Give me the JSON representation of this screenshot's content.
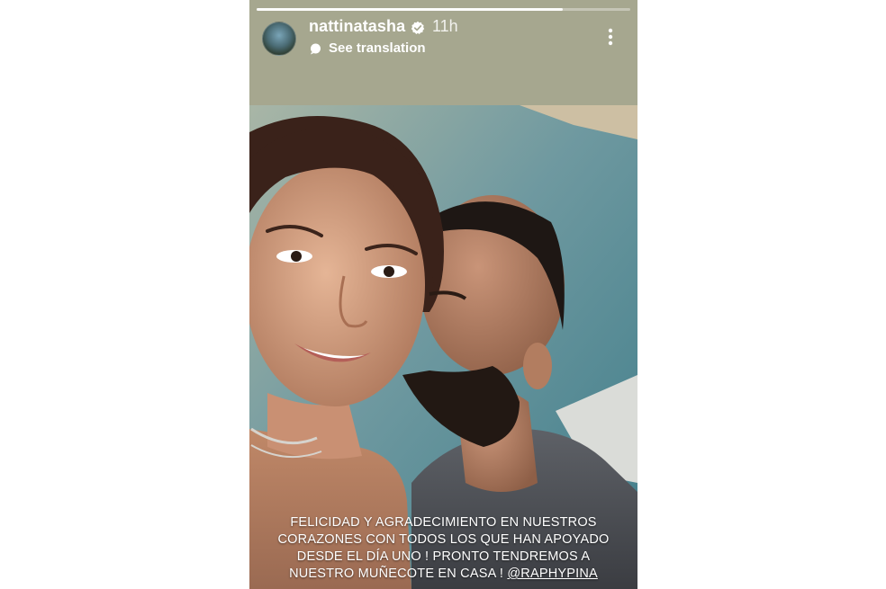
{
  "story": {
    "username": "nattinatasha",
    "time_ago": "11h",
    "see_translation": "See translation",
    "progress": 0.82,
    "background_color": "#a6a78f",
    "icons": {
      "verified": "verified-badge-icon",
      "translate": "translate-bubble-icon",
      "menu": "more-vertical-icon"
    },
    "caption": {
      "line1": "FELICIDAD Y AGRADECIMIENTO EN NUESTROS",
      "line2": "CORAZONES CON TODOS LOS QUE HAN APOYADO",
      "line3": "DESDE EL DÍA UNO ! PRONTO TENDREMOS A",
      "line4_prefix": "NUESTRO MUÑECOTE EN CASA ! ",
      "mention": "@RAPHYPINA"
    }
  }
}
